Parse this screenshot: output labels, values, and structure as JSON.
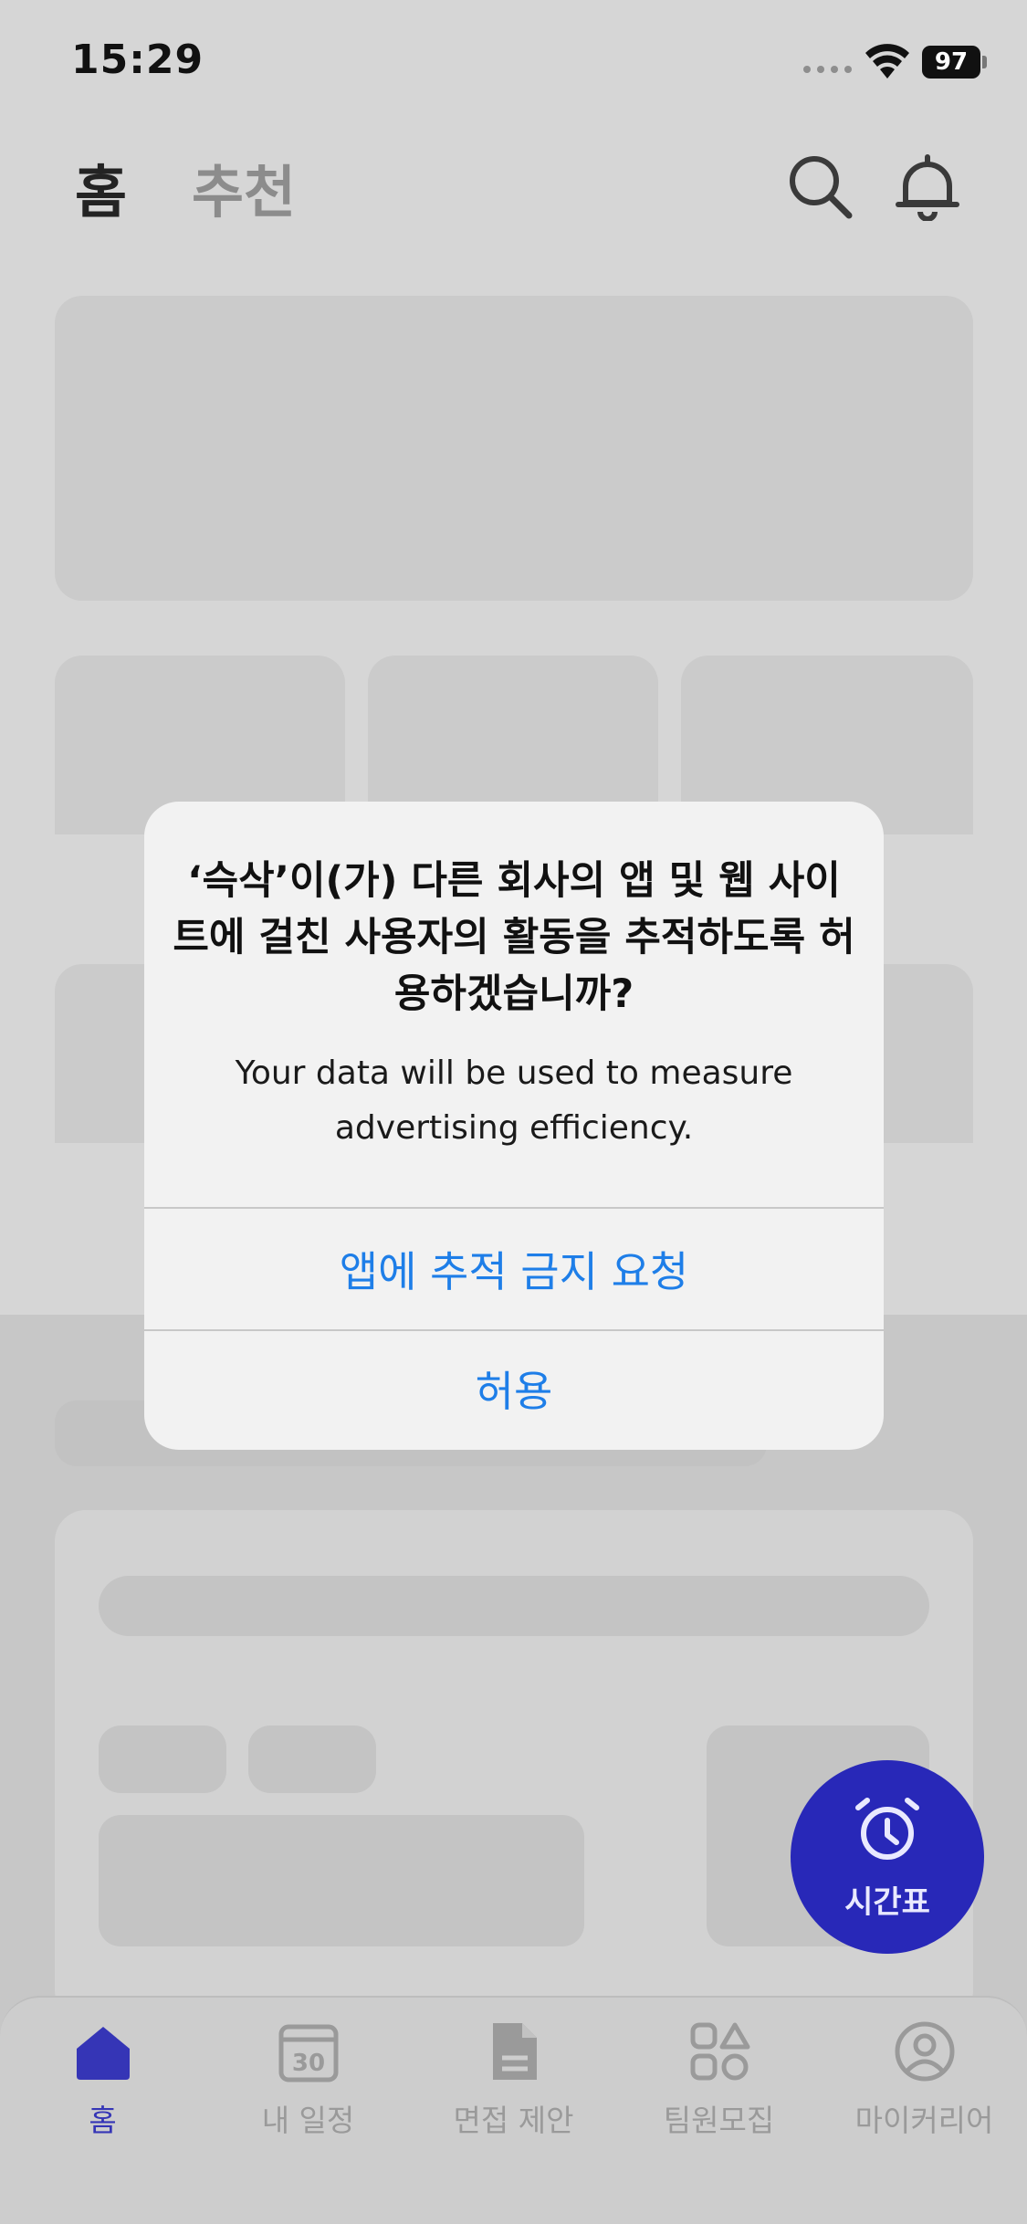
{
  "status_bar": {
    "time": "15:29",
    "battery": "97"
  },
  "header": {
    "tabs": [
      {
        "label": "홈",
        "active": true
      },
      {
        "label": "추천",
        "active": false
      }
    ],
    "icons": [
      "search-icon",
      "bell-icon"
    ]
  },
  "fab": {
    "label": "시간표",
    "icon": "alarm-clock-icon"
  },
  "tabbar": {
    "items": [
      {
        "label": "홈",
        "icon": "home-icon",
        "active": true
      },
      {
        "label": "내 일정",
        "icon": "calendar-icon",
        "active": false,
        "badge": "30"
      },
      {
        "label": "면접 제안",
        "icon": "document-icon",
        "active": false
      },
      {
        "label": "팀원모집",
        "icon": "shapes-icon",
        "active": false
      },
      {
        "label": "마이커리어",
        "icon": "profile-icon",
        "active": false
      }
    ]
  },
  "alert": {
    "title": "‘슥삭’이(가) 다른 회사의 앱 및 웹 사이트에 걸친 사용자의 활동을 추적하도록 허용하겠습니까?",
    "message": "Your data will be used to measure advertising efficiency.",
    "buttons": {
      "deny": "앱에 추적 금지 요청",
      "allow": "허용"
    }
  },
  "colors": {
    "accent_blue": "#1e7ee8",
    "fab_indigo": "#2828b8",
    "active_tab": "#3535b6"
  }
}
